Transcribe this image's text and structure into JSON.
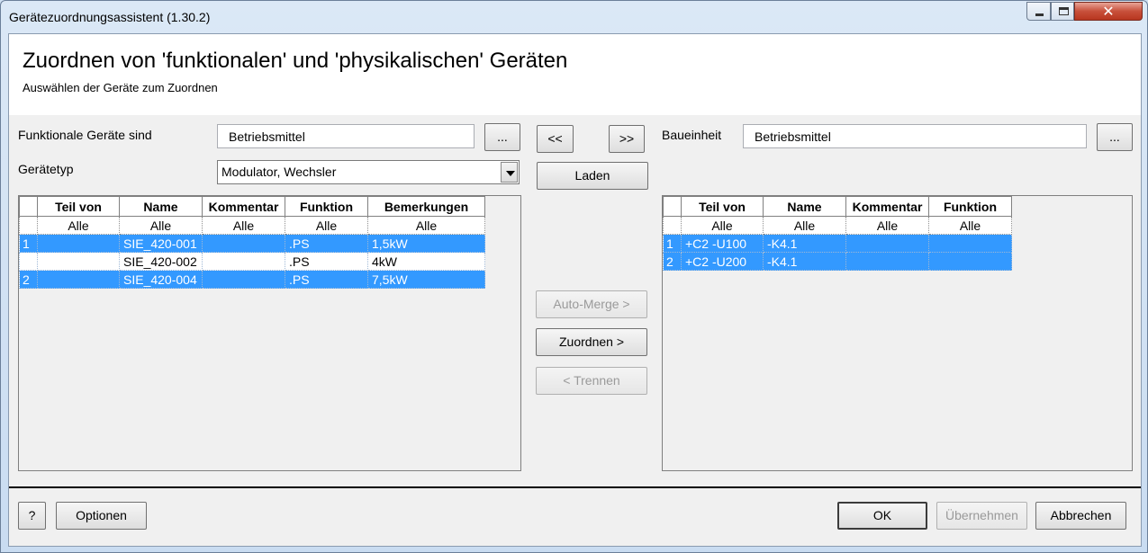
{
  "window": {
    "title": "Gerätezuordnungsassistent (1.30.2)",
    "controls": [
      "minimize-icon",
      "maximize-icon",
      "close-icon"
    ]
  },
  "header": {
    "title": "Zuordnen von 'funktionalen' und 'physikalischen' Geräten",
    "subtitle": "Auswählen der Geräte zum Zuordnen"
  },
  "left": {
    "functional_label": "Funktionale Geräte sind",
    "functional_value": "Betriebsmittel",
    "browse_label": "...",
    "devicetype_label": "Gerätetyp",
    "devicetype_value": "Modulator, Wechsler",
    "columns": [
      "Teil von",
      "Name",
      "Kommentar",
      "Funktion",
      "Bemerkungen"
    ],
    "filter": [
      "Alle",
      "Alle",
      "Alle",
      "Alle",
      "Alle"
    ],
    "rows": [
      {
        "num": "1",
        "teil": "",
        "name": "SIE_420-001",
        "kommentar": "",
        "funktion": ".PS",
        "bemerkungen": "1,5kW",
        "selected": true
      },
      {
        "num": "",
        "teil": "",
        "name": "SIE_420-002",
        "kommentar": "",
        "funktion": ".PS",
        "bemerkungen": "4kW",
        "selected": false
      },
      {
        "num": "2",
        "teil": "",
        "name": "SIE_420-004",
        "kommentar": "",
        "funktion": ".PS",
        "bemerkungen": "7,5kW",
        "selected": true
      }
    ]
  },
  "middle": {
    "prev_label": "<<",
    "next_label": ">>",
    "load_label": "Laden",
    "automerge_label": "Auto-Merge >",
    "assign_label": "Zuordnen >",
    "separate_label": "< Trennen"
  },
  "right": {
    "unit_label": "Baueinheit",
    "unit_value": "Betriebsmittel",
    "browse_label": "...",
    "columns": [
      "Teil von",
      "Name",
      "Kommentar",
      "Funktion"
    ],
    "filter": [
      "Alle",
      "Alle",
      "Alle",
      "Alle"
    ],
    "rows": [
      {
        "num": "1",
        "teil": "+C2 -U100",
        "name": "-K4.1",
        "kommentar": "",
        "funktion": "",
        "selected": true
      },
      {
        "num": "2",
        "teil": "+C2 -U200",
        "name": "-K4.1",
        "kommentar": "",
        "funktion": "",
        "selected": true
      }
    ]
  },
  "footer": {
    "help_label": "?",
    "options_label": "Optionen",
    "ok_label": "OK",
    "apply_label": "Übernehmen",
    "cancel_label": "Abbrechen"
  },
  "colors": {
    "selection": "#3399ff",
    "window_frame": "#c9dcf1",
    "client_bg": "#f0f0f0"
  }
}
